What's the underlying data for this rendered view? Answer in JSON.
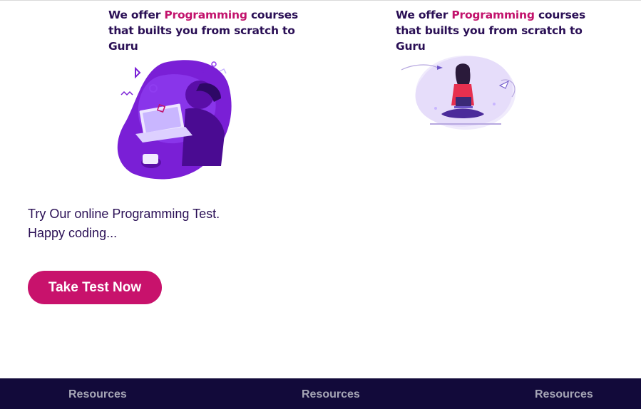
{
  "promos": [
    {
      "prefix": "We offer ",
      "highlight": "Programming",
      "suffix": " courses that builts you from scratch to Guru"
    },
    {
      "prefix": "We offer ",
      "highlight": "Programming",
      "suffix": " courses that builts you from scratch to Guru"
    }
  ],
  "cta": {
    "line1": "Try Our online Programming Test.",
    "line2": "Happy coding...",
    "button_label": "Take Test Now"
  },
  "footer": {
    "links": [
      "Resources",
      "Resources",
      "Resources"
    ]
  },
  "colors": {
    "brand_dark": "#2a0f55",
    "accent": "#c2126c",
    "footer_bg": "#120a3a"
  }
}
